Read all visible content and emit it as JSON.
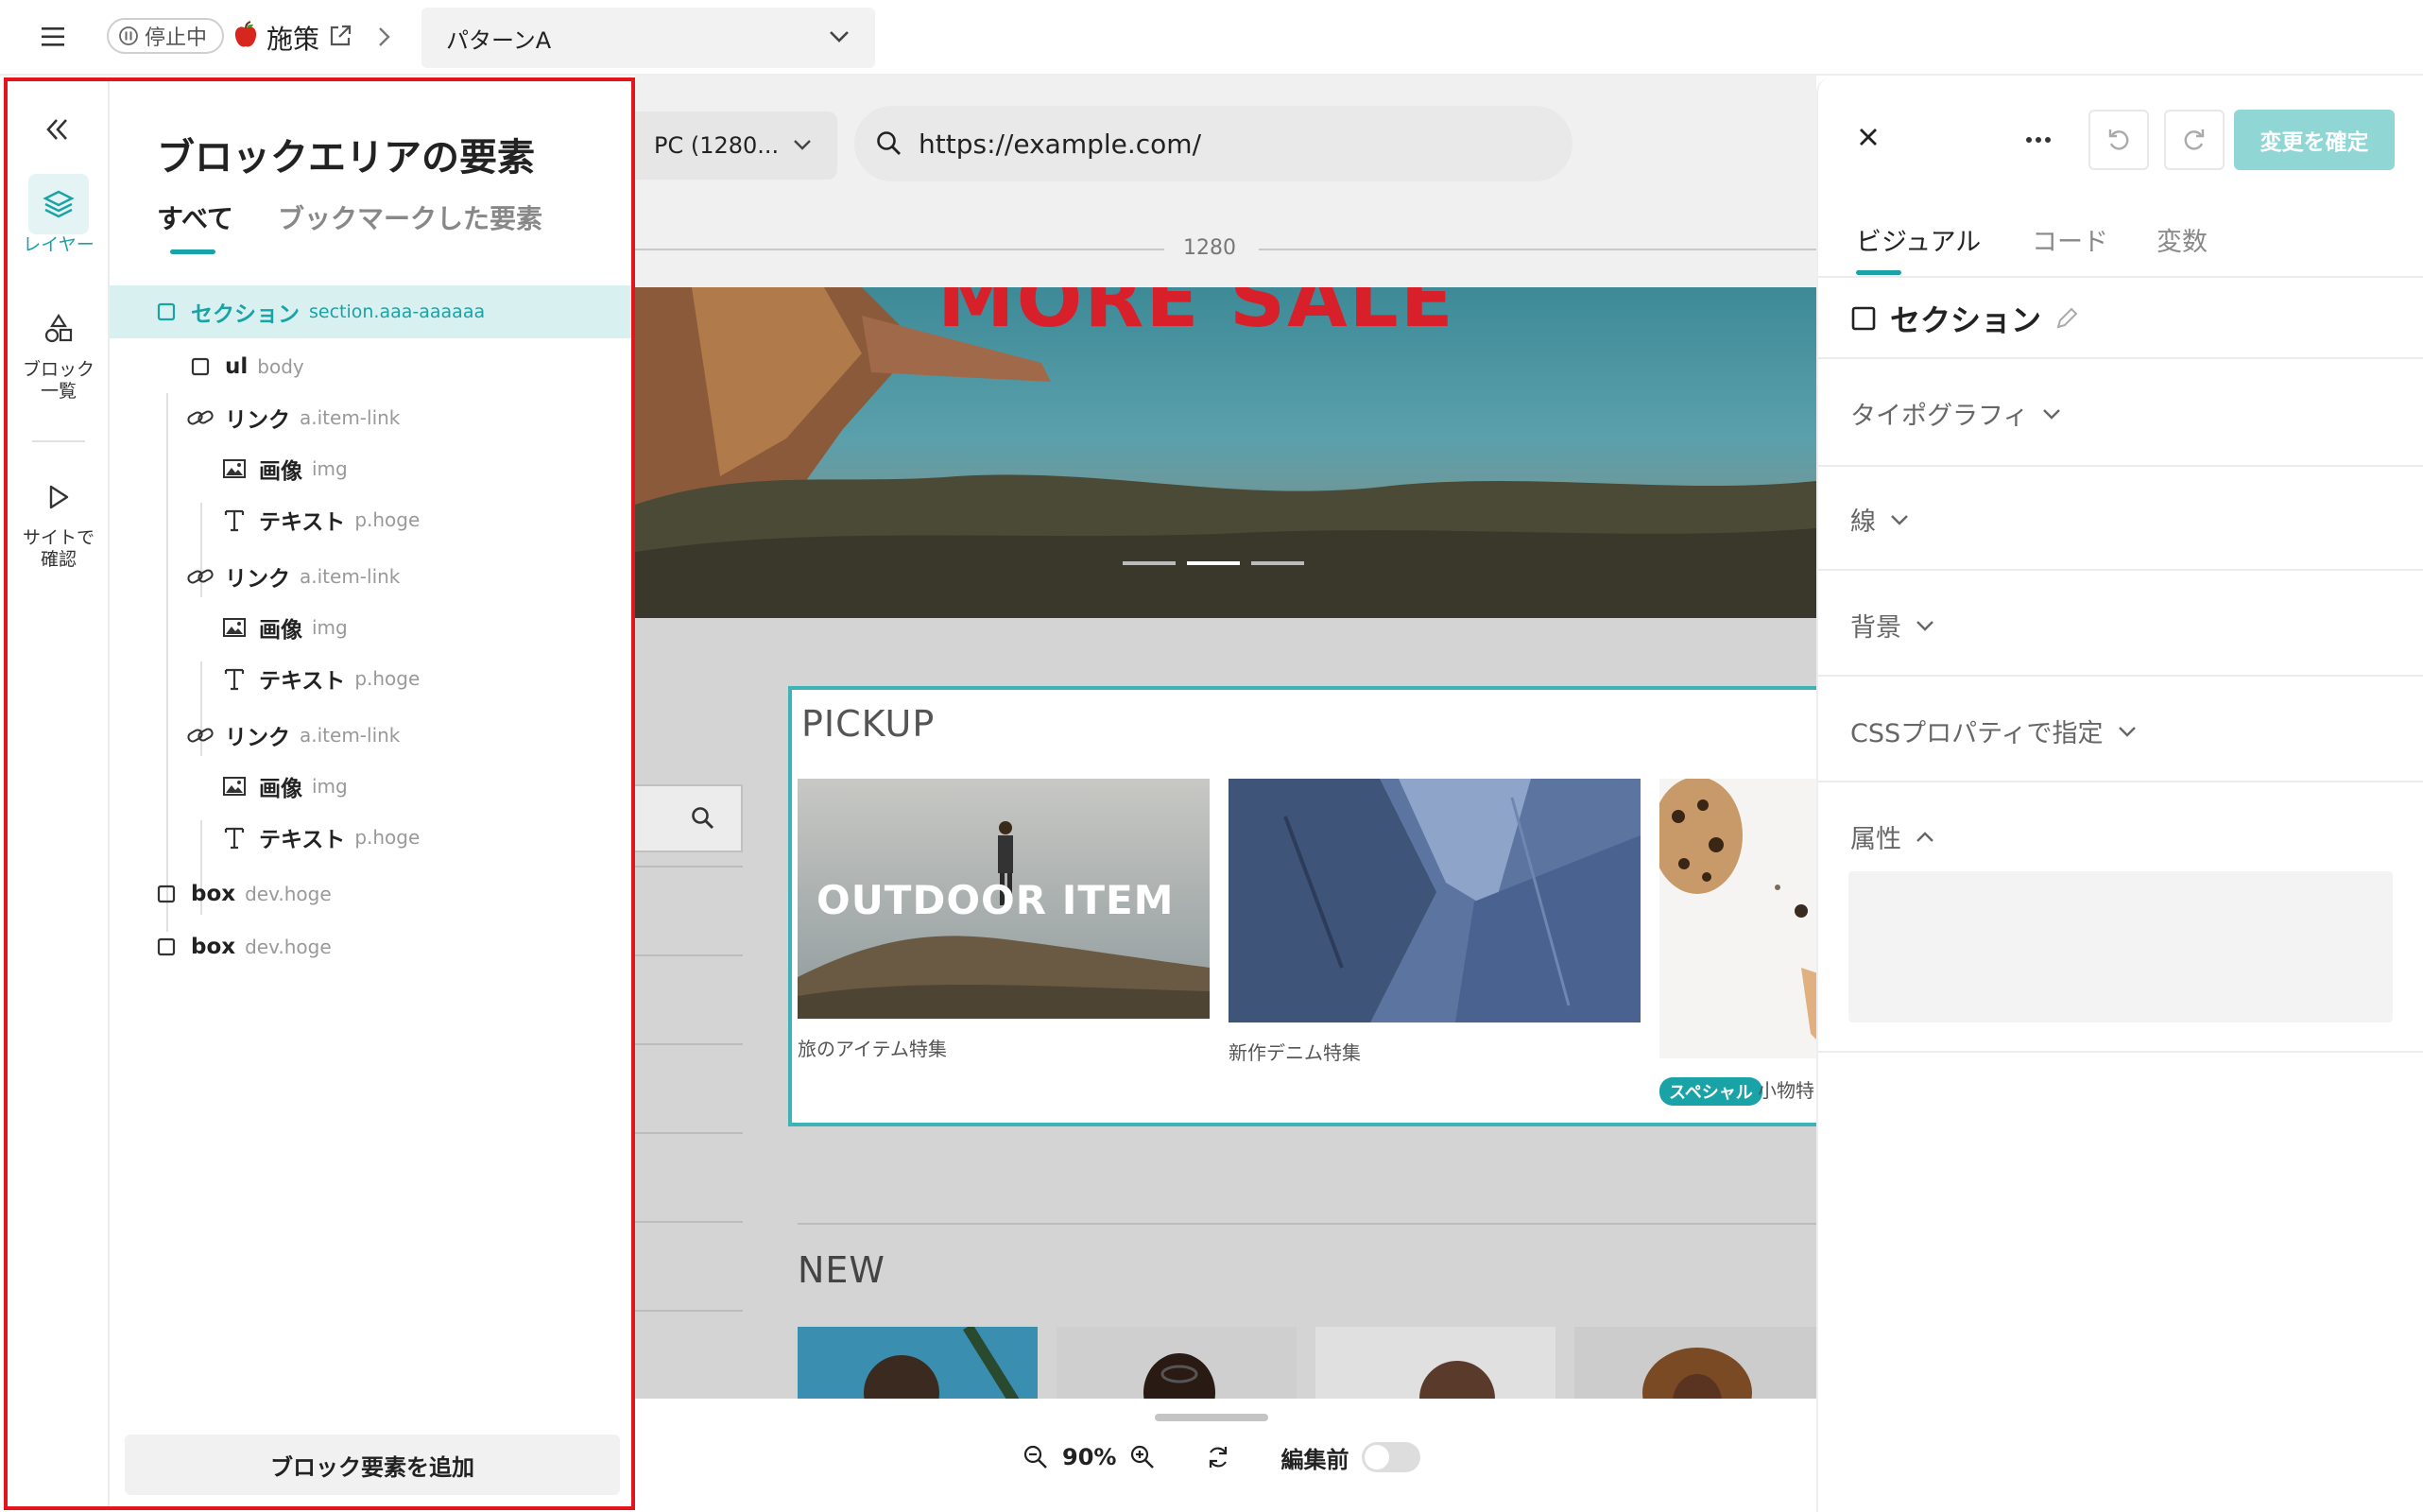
{
  "topbar": {
    "status": "停止中",
    "campaign": "施策",
    "pattern": "パターンA"
  },
  "left_panel": {
    "rail": {
      "layers_label": "レイヤー",
      "blocks_label": "ブロック一覧",
      "site_label": "サイトで確認"
    },
    "title": "ブロックエリアの要素",
    "tabs": [
      "すべて",
      "ブックマークした要素"
    ],
    "tree": [
      {
        "label": "セクション",
        "sub": "section.aaa-aaaaaa"
      },
      {
        "label": "ul",
        "sub": "body"
      },
      {
        "label": "リンク",
        "sub": "a.item-link"
      },
      {
        "label": "画像",
        "sub": "img"
      },
      {
        "label": "テキスト",
        "sub": "p.hoge"
      },
      {
        "label": "リンク",
        "sub": "a.item-link"
      },
      {
        "label": "画像",
        "sub": "img"
      },
      {
        "label": "テキスト",
        "sub": "p.hoge"
      },
      {
        "label": "リンク",
        "sub": "a.item-link"
      },
      {
        "label": "画像",
        "sub": "img"
      },
      {
        "label": "テキスト",
        "sub": "p.hoge"
      },
      {
        "label": "box",
        "sub": "dev.hoge"
      },
      {
        "label": "box",
        "sub": "dev.hoge"
      }
    ],
    "add_button": "ブロック要素を追加"
  },
  "preview": {
    "device": "PC (1280...",
    "url": "https://example.com/",
    "ruler": "1280",
    "hero_text": "MORE SALE",
    "pickup_title": "PICKUP",
    "card1_overlay": "OUTDOOR ITEM",
    "card1_caption": "旅のアイテム特集",
    "card2_caption": "新作デニム特集",
    "card3_badge": "スペシャル",
    "card3_caption": "小物特",
    "new_title": "NEW",
    "zoom": "90%",
    "before_edit": "編集前"
  },
  "right_panel": {
    "confirm": "変更を確定",
    "tabs": [
      "ビジュアル",
      "コード",
      "変数"
    ],
    "element_name": "セクション",
    "sections": [
      "タイポグラフィ",
      "線",
      "背景",
      "CSSプロパティで指定",
      "属性"
    ]
  },
  "colors": {
    "accent": "#1aa3a6",
    "highlight": "#e0161c",
    "hero_text": "#d8202a"
  }
}
